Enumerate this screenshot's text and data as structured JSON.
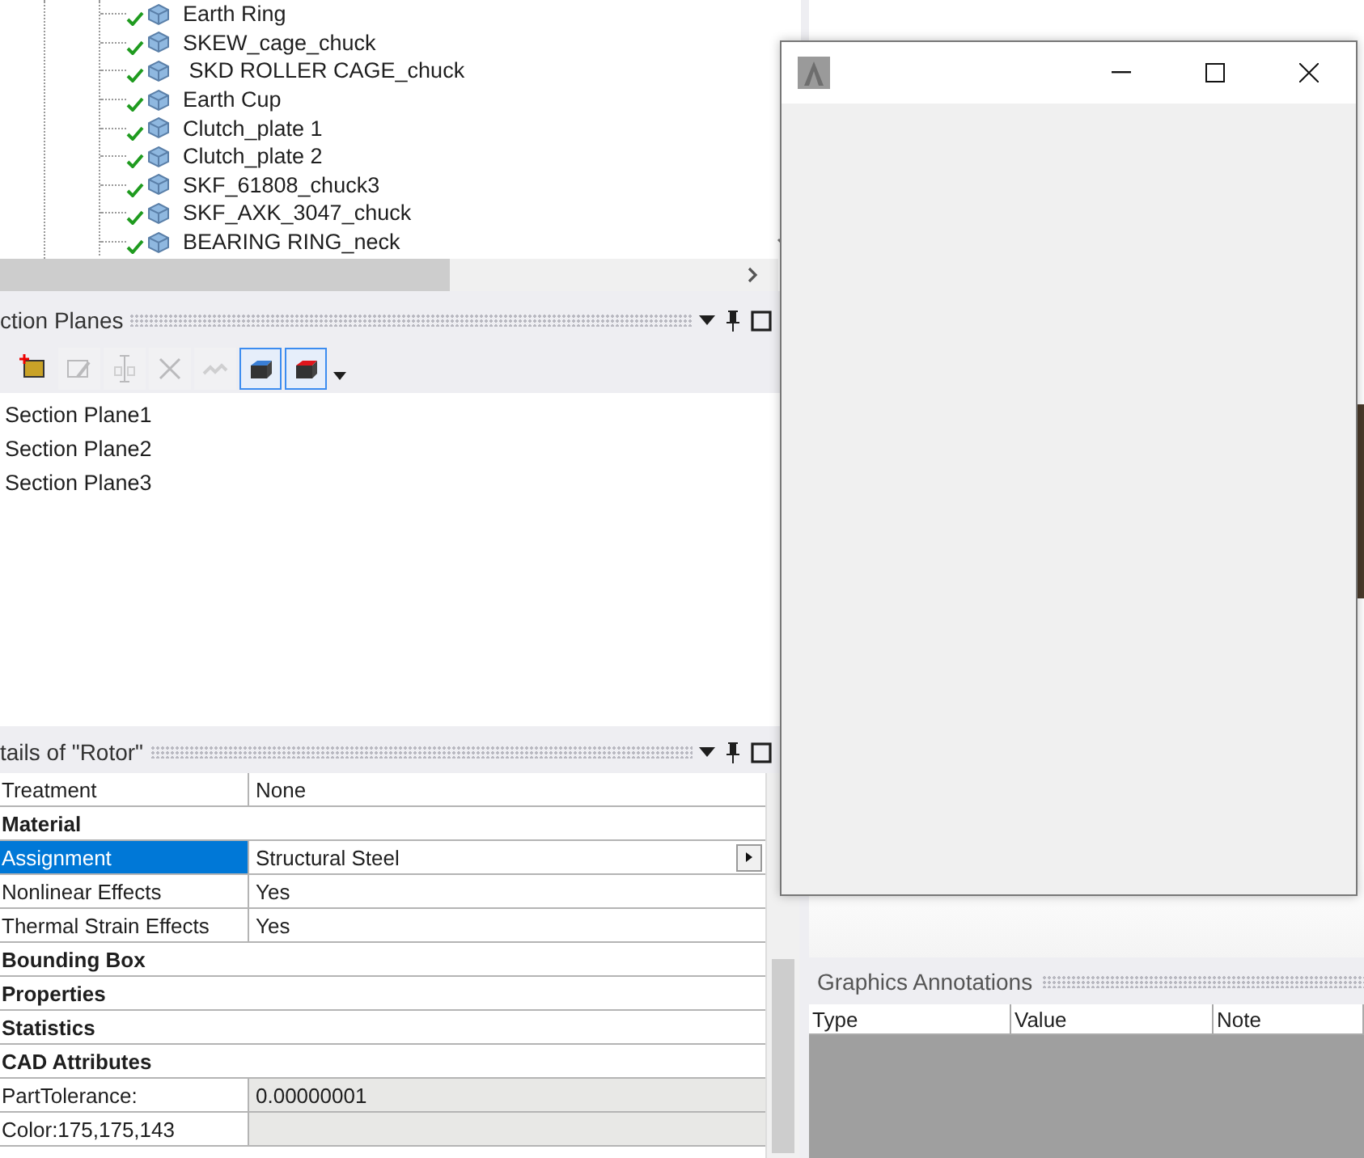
{
  "tree": {
    "items": [
      {
        "label": "Earth Ring",
        "checked": true
      },
      {
        "label": "SKEW_cage_chuck",
        "checked": true
      },
      {
        "label": " SKD ROLLER CAGE_chuck",
        "checked": true
      },
      {
        "label": "Earth Cup",
        "checked": true
      },
      {
        "label": "Clutch_plate 1",
        "checked": true
      },
      {
        "label": "Clutch_plate 2",
        "checked": true
      },
      {
        "label": "SKF_61808_chuck3",
        "checked": true
      },
      {
        "label": "SKF_AXK_3047_chuck",
        "checked": true
      },
      {
        "label": "BEARING RING_neck",
        "checked": true
      }
    ]
  },
  "section_planes": {
    "title": "ction Planes",
    "tools": [
      {
        "kind": "add",
        "disabled": false,
        "on": false
      },
      {
        "kind": "edit",
        "disabled": true,
        "on": false
      },
      {
        "kind": "rename",
        "disabled": true,
        "on": false
      },
      {
        "kind": "delete",
        "disabled": true,
        "on": false
      },
      {
        "kind": "link",
        "disabled": true,
        "on": false
      },
      {
        "kind": "solid-cap",
        "disabled": false,
        "on": true
      },
      {
        "kind": "cut-cap",
        "disabled": false,
        "on": true
      },
      {
        "kind": "more",
        "disabled": false,
        "on": false
      }
    ],
    "items": [
      "Section Plane1",
      "Section Plane2",
      "Section Plane3"
    ]
  },
  "details": {
    "title": "tails of \"Rotor\"",
    "rows": [
      {
        "kind": "property",
        "name": "Treatment",
        "value": "None",
        "selected": false,
        "readonly": false
      },
      {
        "kind": "group",
        "name": "Material",
        "selected": false
      },
      {
        "kind": "property",
        "name": "Assignment",
        "value": "Structural Steel",
        "selected": true,
        "readonly": false,
        "picker": true
      },
      {
        "kind": "property",
        "name": "Nonlinear Effects",
        "value": "Yes",
        "selected": false,
        "readonly": false
      },
      {
        "kind": "property",
        "name": "Thermal Strain Effects",
        "value": "Yes",
        "selected": false,
        "readonly": false
      },
      {
        "kind": "group",
        "name": "Bounding Box",
        "selected": false
      },
      {
        "kind": "group",
        "name": "Properties",
        "selected": false
      },
      {
        "kind": "group",
        "name": "Statistics",
        "selected": false
      },
      {
        "kind": "group",
        "name": "CAD Attributes",
        "selected": false
      },
      {
        "kind": "property",
        "name": "PartTolerance:",
        "value": "0.00000001",
        "selected": false,
        "readonly": true
      },
      {
        "kind": "property",
        "name": "Color:175,175,143",
        "selected": false,
        "readonly": true
      }
    ]
  },
  "graphics_annotations": {
    "title": "Graphics Annotations",
    "columns": [
      "Type",
      "Value",
      "Note"
    ]
  }
}
